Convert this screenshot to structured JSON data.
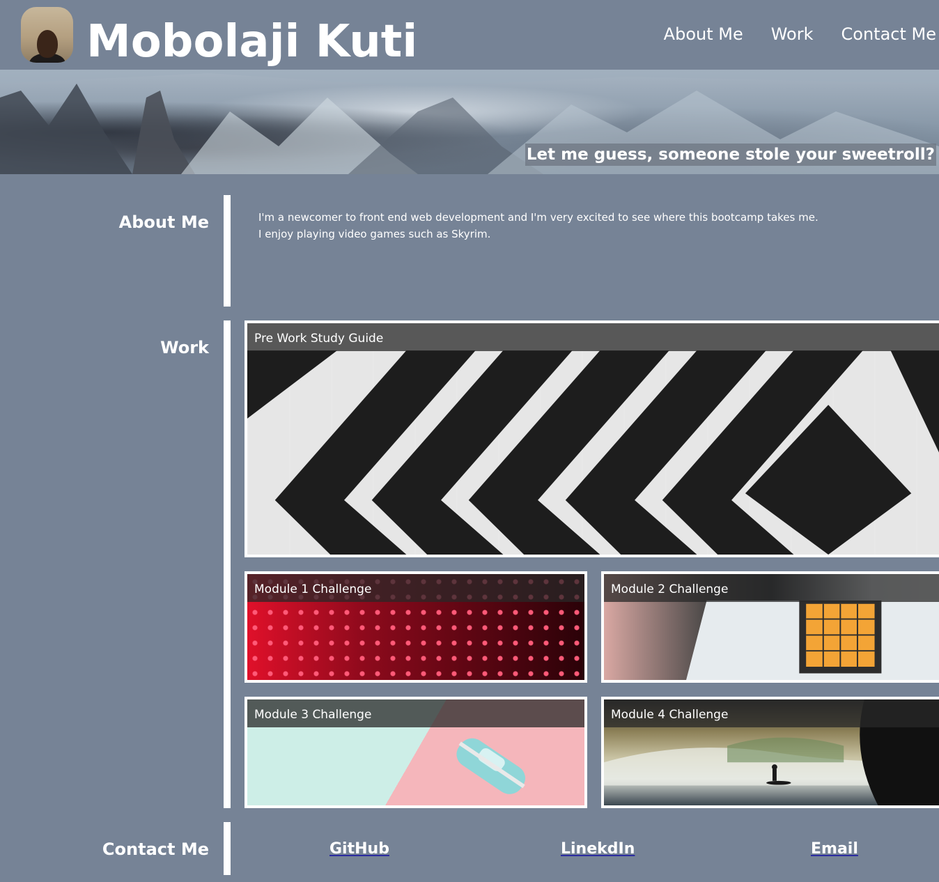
{
  "header": {
    "site_title": "Mobolaji Kuti",
    "nav": [
      "About Me",
      "Work",
      "Contact Me"
    ]
  },
  "hero": {
    "tagline": "Let me guess, someone stole your sweetroll?"
  },
  "about": {
    "label": "About Me",
    "lines": [
      "I'm a newcomer to front end web development and I'm very excited to see where this bootcamp takes me.",
      "I enjoy playing video games such as Skyrim."
    ]
  },
  "work": {
    "label": "Work",
    "cards": [
      {
        "title": "Pre Work Study Guide"
      },
      {
        "title": "Module 1 Challenge"
      },
      {
        "title": "Module 2 Challenge"
      },
      {
        "title": "Module 3 Challenge"
      },
      {
        "title": "Module 4 Challenge"
      }
    ]
  },
  "contact": {
    "label": "Contact Me",
    "links": [
      "GitHub",
      "LinekdIn",
      "Email"
    ]
  },
  "colors": {
    "background": "#768396",
    "text": "#ffffff",
    "card_border": "#ffffff",
    "link_underline": "#2a2aa0"
  }
}
